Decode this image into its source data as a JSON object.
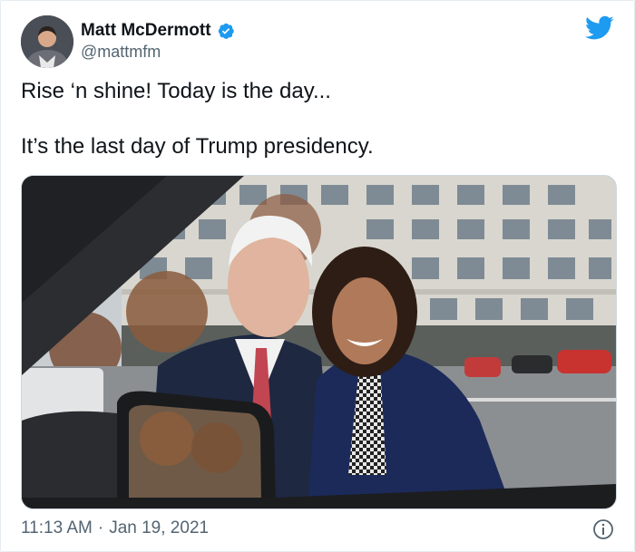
{
  "user": {
    "display_name": "Matt McDermott",
    "handle": "@mattmfm",
    "verified": true
  },
  "tweet": {
    "lines": [
      "Rise ‘n shine! Today is the day...",
      "It’s the last day of Trump presidency."
    ],
    "time": "11:13 AM",
    "separator": "·",
    "date": "Jan 19, 2021"
  },
  "icons": {
    "brand": "twitter-bird-icon",
    "verified": "verified-badge-icon",
    "info": "info-icon"
  },
  "colors": {
    "brand_blue": "#1d9bf0",
    "text": "#0f1419",
    "muted": "#536471"
  }
}
